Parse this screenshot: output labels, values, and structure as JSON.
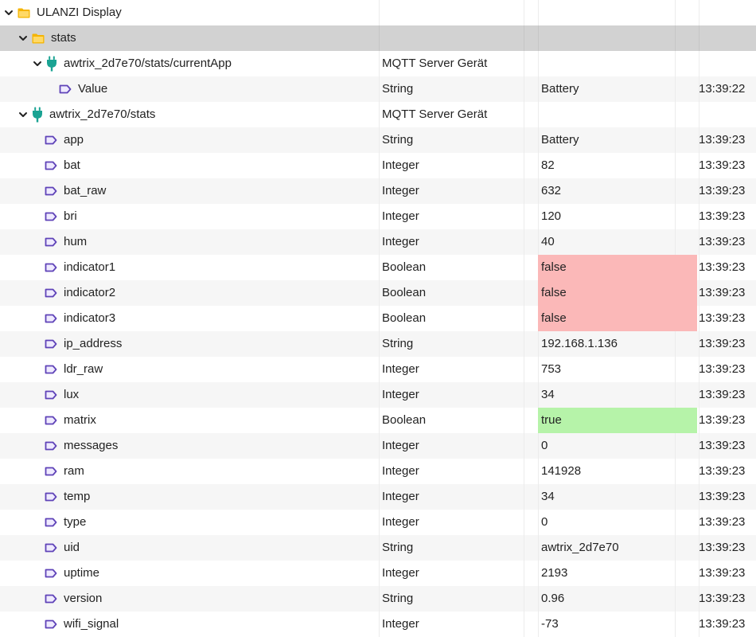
{
  "tree": {
    "rows": [
      {
        "kind": "folder",
        "name": "ULANZI Display",
        "expanded": true,
        "level": 0,
        "type": "",
        "value": "",
        "time": "",
        "icon": "folder-icon"
      },
      {
        "kind": "folder",
        "name": "stats",
        "expanded": true,
        "level": 1,
        "selected": true,
        "type": "",
        "value": "",
        "time": "",
        "icon": "folder-icon"
      },
      {
        "kind": "device",
        "name": "awtrix_2d7e70/stats/currentApp",
        "expanded": true,
        "level": 2,
        "type": "MQTT Server Gerät",
        "value": "",
        "time": "",
        "icon": "plug-icon"
      },
      {
        "kind": "state",
        "name": "Value",
        "level": 4,
        "type": "String",
        "value": "Battery",
        "time": "13:39:22",
        "icon": "state-tag-icon"
      },
      {
        "kind": "device",
        "name": "awtrix_2d7e70/stats",
        "expanded": true,
        "level": 1,
        "type": "MQTT Server Gerät",
        "value": "",
        "time": "",
        "icon": "plug-icon"
      },
      {
        "kind": "state",
        "name": "app",
        "level": 3,
        "type": "String",
        "value": "Battery",
        "time": "13:39:23",
        "icon": "state-tag-icon"
      },
      {
        "kind": "state",
        "name": "bat",
        "level": 3,
        "type": "Integer",
        "value": "82",
        "time": "13:39:23",
        "icon": "state-tag-icon"
      },
      {
        "kind": "state",
        "name": "bat_raw",
        "level": 3,
        "type": "Integer",
        "value": "632",
        "time": "13:39:23",
        "icon": "state-tag-icon"
      },
      {
        "kind": "state",
        "name": "bri",
        "level": 3,
        "type": "Integer",
        "value": "120",
        "time": "13:39:23",
        "icon": "state-tag-icon"
      },
      {
        "kind": "state",
        "name": "hum",
        "level": 3,
        "type": "Integer",
        "value": "40",
        "time": "13:39:23",
        "icon": "state-tag-icon"
      },
      {
        "kind": "state",
        "name": "indicator1",
        "level": 3,
        "type": "Boolean",
        "value": "false",
        "time": "13:39:23",
        "icon": "state-tag-icon"
      },
      {
        "kind": "state",
        "name": "indicator2",
        "level": 3,
        "type": "Boolean",
        "value": "false",
        "time": "13:39:23",
        "icon": "state-tag-icon"
      },
      {
        "kind": "state",
        "name": "indicator3",
        "level": 3,
        "type": "Boolean",
        "value": "false",
        "time": "13:39:23",
        "icon": "state-tag-icon"
      },
      {
        "kind": "state",
        "name": "ip_address",
        "level": 3,
        "type": "String",
        "value": "192.168.1.136",
        "time": "13:39:23",
        "icon": "state-tag-icon"
      },
      {
        "kind": "state",
        "name": "ldr_raw",
        "level": 3,
        "type": "Integer",
        "value": "753",
        "time": "13:39:23",
        "icon": "state-tag-icon"
      },
      {
        "kind": "state",
        "name": "lux",
        "level": 3,
        "type": "Integer",
        "value": "34",
        "time": "13:39:23",
        "icon": "state-tag-icon"
      },
      {
        "kind": "state",
        "name": "matrix",
        "level": 3,
        "type": "Boolean",
        "value": "true",
        "time": "13:39:23",
        "icon": "state-tag-icon"
      },
      {
        "kind": "state",
        "name": "messages",
        "level": 3,
        "type": "Integer",
        "value": "0",
        "time": "13:39:23",
        "icon": "state-tag-icon"
      },
      {
        "kind": "state",
        "name": "ram",
        "level": 3,
        "type": "Integer",
        "value": "141928",
        "time": "13:39:23",
        "icon": "state-tag-icon"
      },
      {
        "kind": "state",
        "name": "temp",
        "level": 3,
        "type": "Integer",
        "value": "34",
        "time": "13:39:23",
        "icon": "state-tag-icon"
      },
      {
        "kind": "state",
        "name": "type",
        "level": 3,
        "type": "Integer",
        "value": "0",
        "time": "13:39:23",
        "icon": "state-tag-icon"
      },
      {
        "kind": "state",
        "name": "uid",
        "level": 3,
        "type": "String",
        "value": "awtrix_2d7e70",
        "time": "13:39:23",
        "icon": "state-tag-icon"
      },
      {
        "kind": "state",
        "name": "uptime",
        "level": 3,
        "type": "Integer",
        "value": "2193",
        "time": "13:39:23",
        "icon": "state-tag-icon"
      },
      {
        "kind": "state",
        "name": "version",
        "level": 3,
        "type": "String",
        "value": "0.96",
        "time": "13:39:23",
        "icon": "state-tag-icon"
      },
      {
        "kind": "state",
        "name": "wifi_signal",
        "level": 3,
        "type": "Integer",
        "value": "-73",
        "time": "13:39:23",
        "icon": "state-tag-icon"
      }
    ]
  },
  "colors": {
    "false_value_bg": "#fbb8b8",
    "true_value_bg": "#b6f3a9",
    "folder_icon": "#f5b400",
    "plug_icon": "#1aa393",
    "state_icon": "#5f43b8",
    "selected_row_bg": "#d2d2d2"
  }
}
